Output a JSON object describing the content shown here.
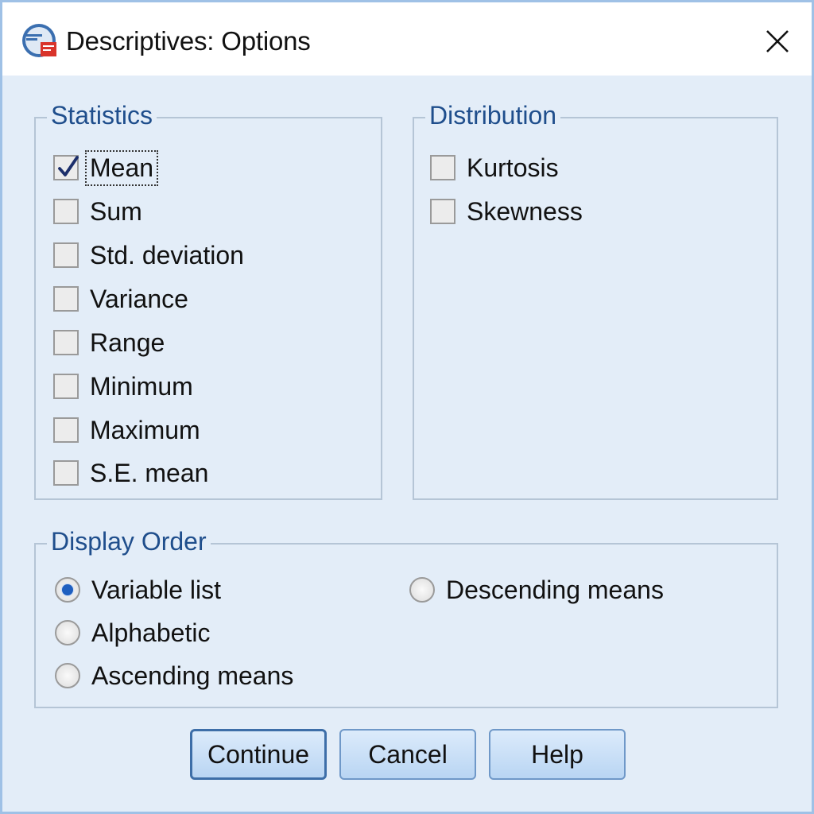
{
  "window": {
    "title": "Descriptives: Options",
    "icon": "spss-app-icon"
  },
  "statistics": {
    "legend": "Statistics",
    "items": [
      {
        "label": "Mean",
        "checked": true
      },
      {
        "label": "Sum",
        "checked": false
      },
      {
        "label": "Std. deviation",
        "checked": false
      },
      {
        "label": "Variance",
        "checked": false
      },
      {
        "label": "Range",
        "checked": false
      },
      {
        "label": "Minimum",
        "checked": false
      },
      {
        "label": "Maximum",
        "checked": false
      },
      {
        "label": "S.E. mean",
        "checked": false
      }
    ]
  },
  "distribution": {
    "legend": "Distribution",
    "items": [
      {
        "label": "Kurtosis",
        "checked": false
      },
      {
        "label": "Skewness",
        "checked": false
      }
    ]
  },
  "display_order": {
    "legend": "Display Order",
    "options": [
      {
        "label": "Variable list",
        "selected": true
      },
      {
        "label": "Alphabetic",
        "selected": false
      },
      {
        "label": "Ascending means",
        "selected": false
      },
      {
        "label": "Descending means",
        "selected": false
      }
    ]
  },
  "buttons": {
    "continue": "Continue",
    "cancel": "Cancel",
    "help": "Help"
  },
  "colors": {
    "accent": "#1f4e8c",
    "selected_radio": "#1f5fbf",
    "background": "#e3edf8"
  }
}
